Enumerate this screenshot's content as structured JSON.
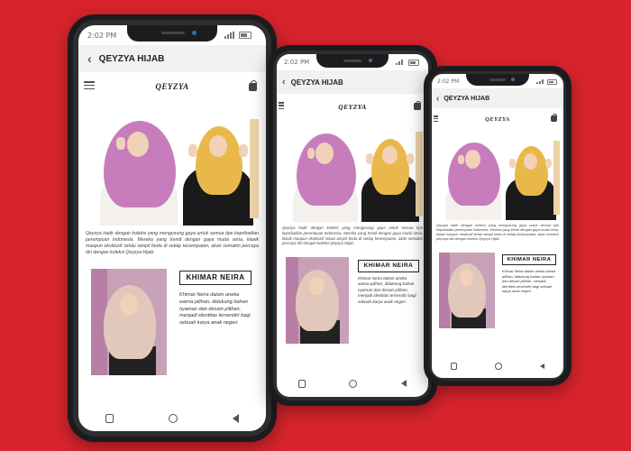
{
  "app": {
    "title": "QEYZYA HIJAB",
    "logo_text": "QEYZYA",
    "status_time": "2:02 PM"
  },
  "content": {
    "description": "Qeyzya hadir dengan koleksi yang mengusung gaya untuk semua tipe kepribadian perempuan Indonesia. Mereka yang trendi dengan gaya muda seria, klasik maupun eksklusif selalu tampil beda di setiap kesempatan, akan semakin percaya diri dengan koleksi Qeyzya Hijab.",
    "product_name": "KHIMAR NEIRA",
    "product_text": "Khimar Neira dalam aneka warna pilihan, didukung bahan nyaman dan desain pilihan, menjadi identitas tersendiri bagi sebuah karya anak negeri."
  },
  "colors": {
    "background": "#d8242c",
    "pink_hijab": "#c77dbb",
    "yellow_hijab": "#e8b94a"
  },
  "icons": {
    "back": "back-arrow-icon",
    "menu": "hamburger-menu-icon",
    "bag": "shopping-bag-icon",
    "nav_recent": "square-icon",
    "nav_home": "circle-icon",
    "nav_back": "triangle-back-icon"
  }
}
